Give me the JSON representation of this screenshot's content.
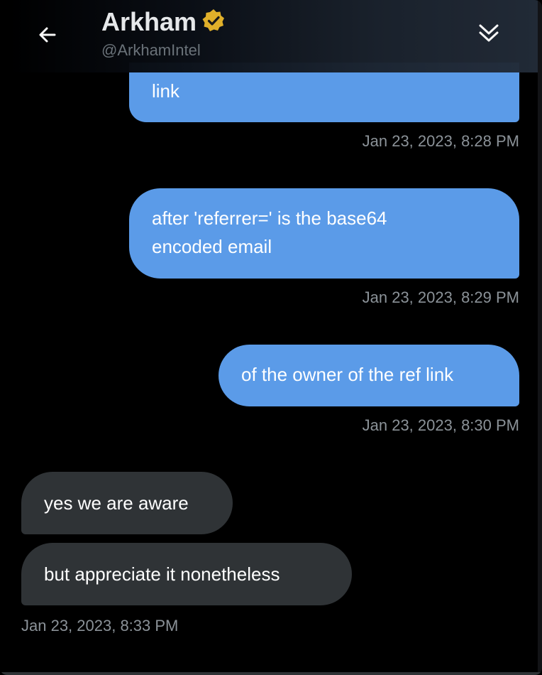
{
  "header": {
    "name": "Arkham",
    "handle": "@ArkhamIntel",
    "verified_badge_color": "#e8b62c",
    "back_icon": "arrow-left-icon",
    "collapse_icon": "double-chevron-down-icon"
  },
  "messages": [
    {
      "side": "sent",
      "text": "link",
      "timestamp": "Jan 23, 2023, 8:28 PM"
    },
    {
      "side": "sent",
      "line1": "after 'referrer=' is the base64",
      "line2": "encoded email",
      "timestamp": "Jan 23, 2023, 8:29 PM"
    },
    {
      "side": "sent",
      "text": "of the owner of the ref link",
      "timestamp": "Jan 23, 2023, 8:30 PM"
    },
    {
      "side": "received",
      "text": "yes we are aware"
    },
    {
      "side": "received",
      "text": "but appreciate it nonetheless",
      "timestamp": "Jan 23, 2023, 8:33 PM"
    }
  ],
  "colors": {
    "background": "#000000",
    "sent_bubble": "#5b9be8",
    "received_bubble": "#2f3336",
    "timestamp": "#8b9298"
  }
}
